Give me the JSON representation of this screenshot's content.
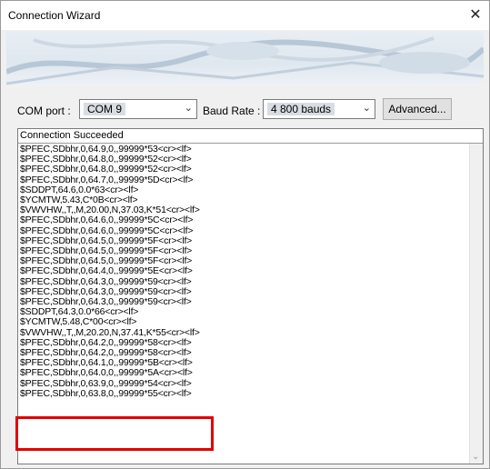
{
  "window": {
    "title": "Connection Wizard",
    "close_glyph": "✕"
  },
  "controls": {
    "com_port_label": "COM port :",
    "com_port_value": "COM 9",
    "baud_rate_label": "Baud Rate :",
    "baud_rate_value": "4 800 bauds",
    "advanced_label": "Advanced...",
    "dropdown_glyph": "⌄"
  },
  "log": {
    "status": "Connection Succeeded",
    "lines": [
      "$PFEC,SDbhr,0,64.9,0,,99999*53<cr><lf>",
      "$PFEC,SDbhr,0,64.8,0,,99999*52<cr><lf>",
      "$PFEC,SDbhr,0,64.8,0,,99999*52<cr><lf>",
      "$PFEC,SDbhr,0,64.7,0,,99999*5D<cr><lf>",
      "$SDDPT,64.6,0.0*63<cr><lf>",
      "$YCMTW,5.43,C*0B<cr><lf>",
      "$VWVHW,,T,,M,20.00,N,37.03,K*51<cr><lf>",
      "$PFEC,SDbhr,0,64.6,0,,99999*5C<cr><lf>",
      "$PFEC,SDbhr,0,64.6,0,,99999*5C<cr><lf>",
      "$PFEC,SDbhr,0,64.5,0,,99999*5F<cr><lf>",
      "$PFEC,SDbhr,0,64.5,0,,99999*5F<cr><lf>",
      "$PFEC,SDbhr,0,64.5,0,,99999*5F<cr><lf>",
      "$PFEC,SDbhr,0,64.4,0,,99999*5E<cr><lf>",
      "$PFEC,SDbhr,0,64.3,0,,99999*59<cr><lf>",
      "$PFEC,SDbhr,0,64.3,0,,99999*59<cr><lf>",
      "$PFEC,SDbhr,0,64.3,0,,99999*59<cr><lf>",
      "$SDDPT,64.3,0.0*66<cr><lf>",
      "$YCMTW,5.48,C*00<cr><lf>",
      "$VWVHW,,T,,M,20.20,N,37.41,K*55<cr><lf>",
      "$PFEC,SDbhr,0,64.2,0,,99999*58<cr><lf>",
      "$PFEC,SDbhr,0,64.2,0,,99999*58<cr><lf>",
      "$PFEC,SDbhr,0,64.1,0,,99999*5B<cr><lf>",
      "$PFEC,SDbhr,0,64.0,0,,99999*5A<cr><lf>",
      "$PFEC,SDbhr,0,63.9,0,,99999*54<cr><lf>",
      "$PFEC,SDbhr,0,63.8,0,,99999*55<cr><lf>"
    ]
  },
  "colors": {
    "highlight": "#e00000",
    "window_bg": "#f0f0f0"
  }
}
